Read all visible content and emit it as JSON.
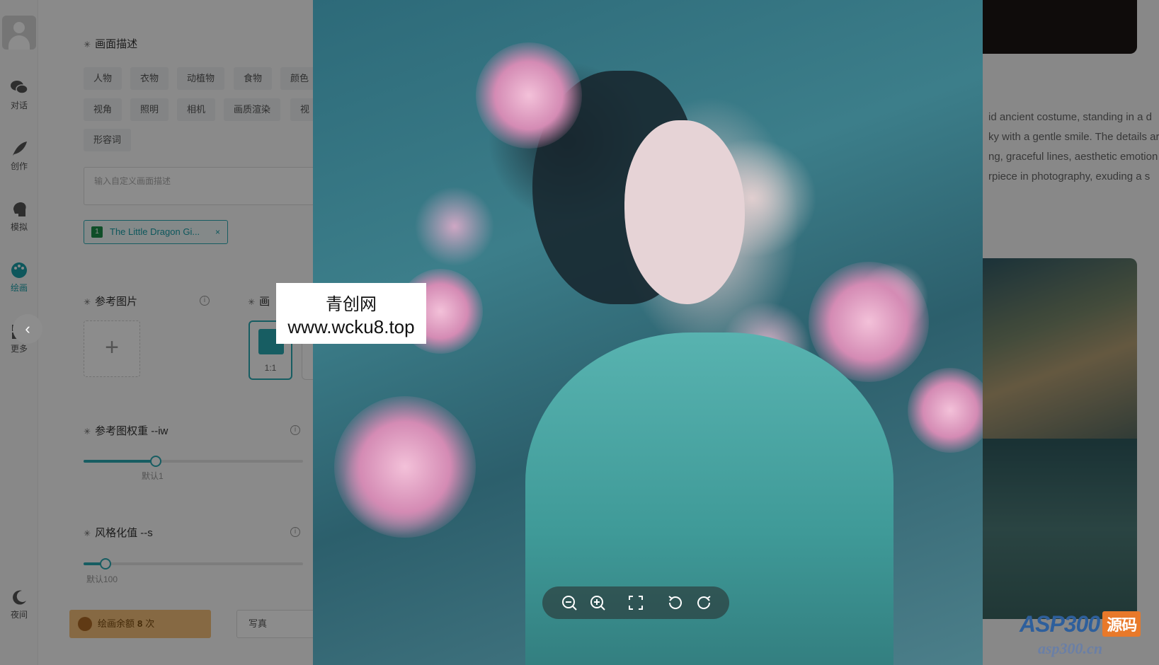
{
  "sidebar": {
    "items": [
      {
        "label": "对话",
        "icon": "chat-icon"
      },
      {
        "label": "创作",
        "icon": "feather-icon"
      },
      {
        "label": "模拟",
        "icon": "head-icon"
      },
      {
        "label": "绘画",
        "icon": "palette-icon",
        "active": true
      },
      {
        "label": "更多",
        "icon": "grid-icon"
      }
    ],
    "night_mode_label": "夜间"
  },
  "panel": {
    "description_title": "画面描述",
    "tags_row1": [
      "人物",
      "衣物",
      "动植物",
      "食物",
      "颜色"
    ],
    "tags_row2": [
      "视角",
      "照明",
      "相机",
      "画质渲染",
      "视"
    ],
    "tags_row3": [
      "形容词"
    ],
    "custom_placeholder": "输入自定义画面描述",
    "lora_chip": {
      "num": "1",
      "label": "The Little Dragon Gi...",
      "close": "×"
    },
    "reference_title": "参考图片",
    "ratio_title": "画",
    "ratio_label": "1:1",
    "ref_weight_title": "参考图权重 --iw",
    "ref_weight_value": 0.33,
    "ref_weight_hint": "默认1",
    "stylize_title": "风格化值 --s",
    "stylize_value": 0.1,
    "stylize_hint": "默认100",
    "quota_prefix": "绘画余额",
    "quota_count": "8",
    "quota_suffix": "次",
    "mode_label": "写真"
  },
  "right": {
    "prompt_lines": [
      "id ancient costume, standing in a d",
      "ky with a gentle smile. The details ar",
      "ng, graceful lines, aesthetic emotion",
      "rpiece in photography, exuding a s"
    ]
  },
  "watermark": {
    "line1": "青创网",
    "line2": "www.wcku8.top"
  },
  "corner_watermark": {
    "brand": "ASP300",
    "tag": "源码",
    "url": "asp300.cn"
  },
  "colors": {
    "accent": "#2aa9b3",
    "quota_bg": "#f4c07a"
  }
}
